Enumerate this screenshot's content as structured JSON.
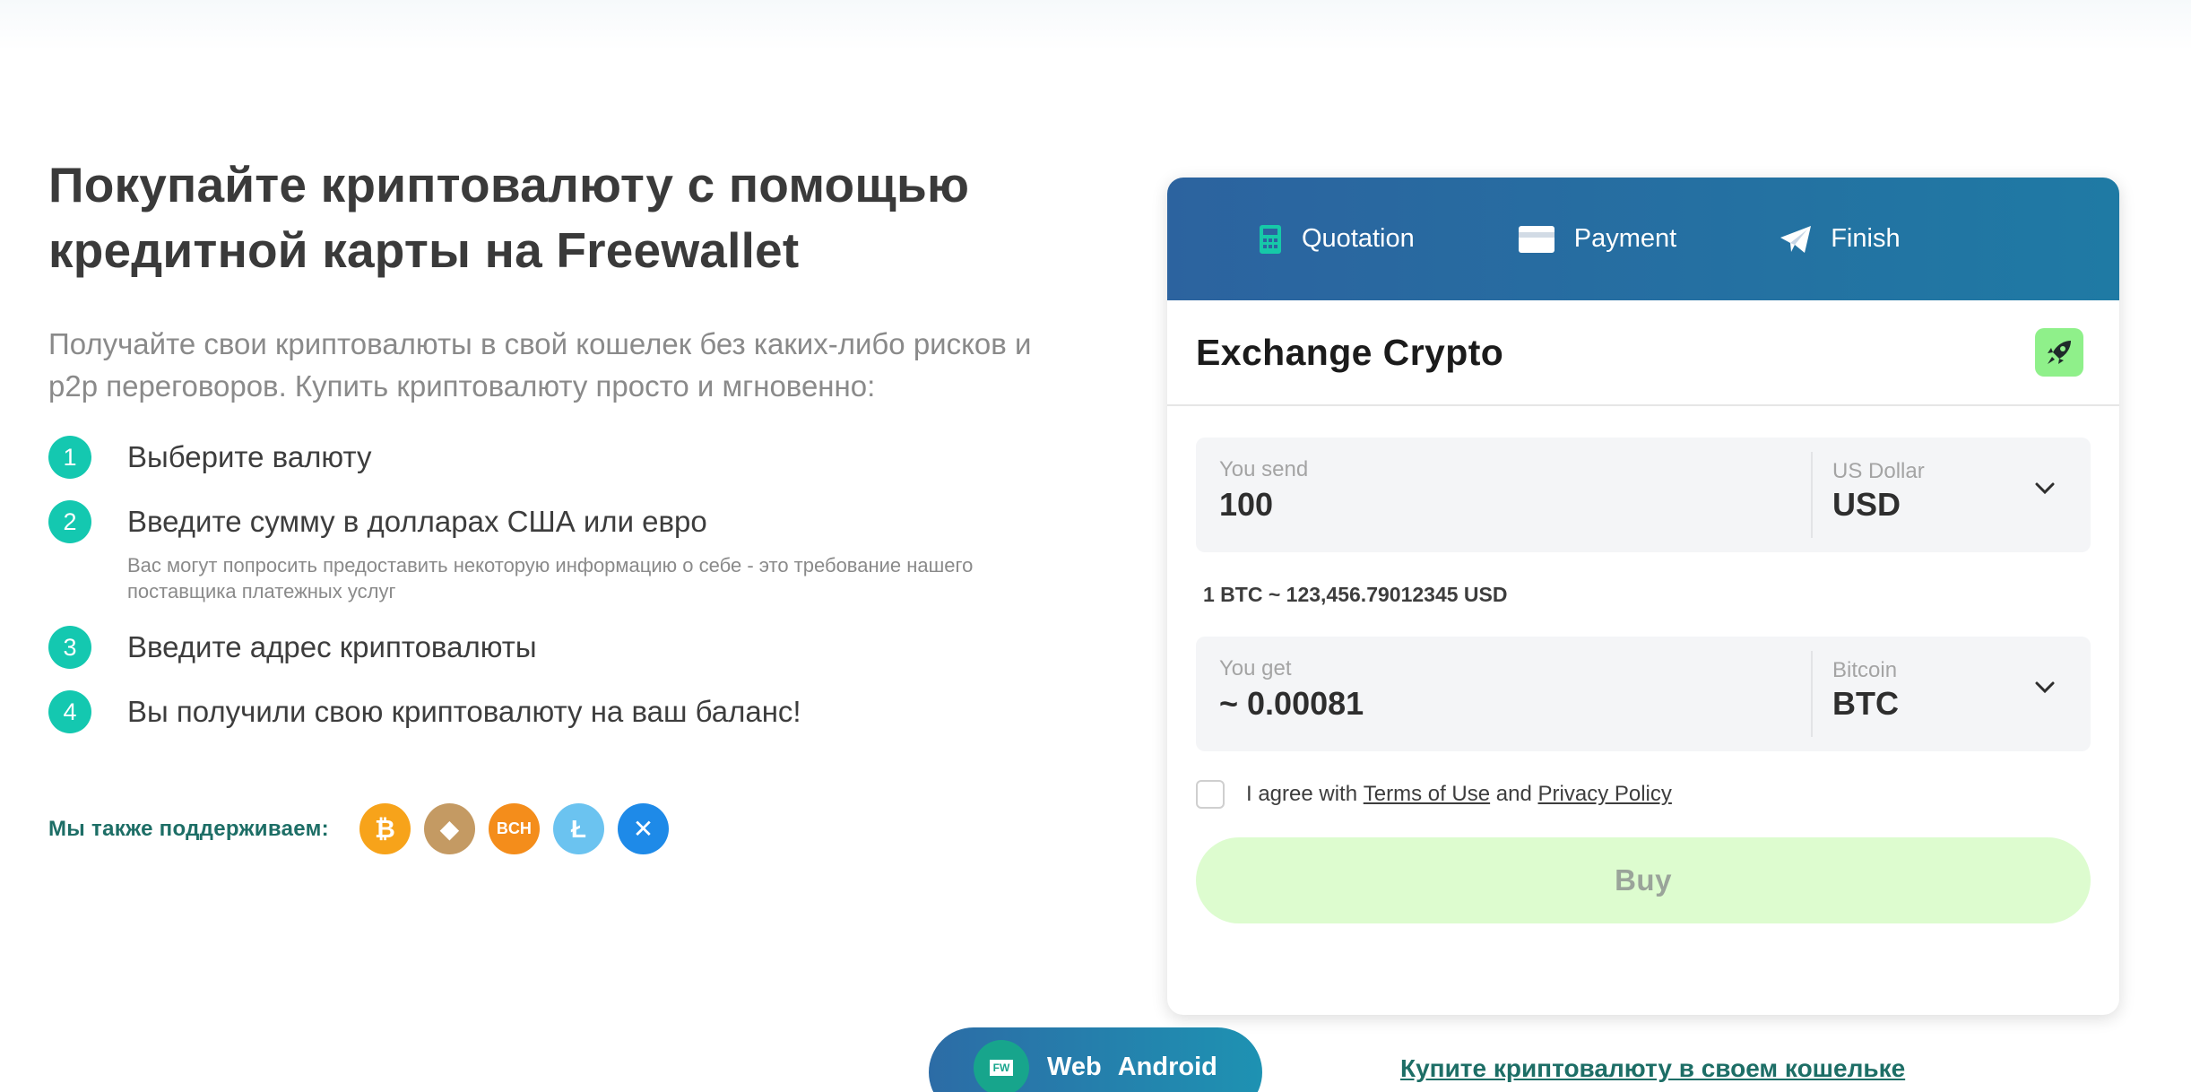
{
  "hero": {
    "title": "Покупайте криптовалюту с помощью кредитной карты на Freewallet",
    "subtitle": "Получайте свои криптовалюты в свой кошелек без каких-либо рисков и p2p переговоров. Купить криптовалюту просто и мгновенно:"
  },
  "steps": [
    {
      "num": "1",
      "text": "Выберите валюту",
      "note": ""
    },
    {
      "num": "2",
      "text": "Введите сумму в долларах США или евро",
      "note": "Вас могут попросить предоставить некоторую информацию о себе - это требование нашего поставщика платежных услуг"
    },
    {
      "num": "3",
      "text": "Введите адрес криптовалюты",
      "note": ""
    },
    {
      "num": "4",
      "text": "Вы получили свою криптовалюту на ваш баланс!",
      "note": ""
    }
  ],
  "supports": {
    "label": "Мы также поддерживаем:",
    "coins": [
      {
        "name": "btc",
        "symbol": "₿",
        "color": "#f7a31a"
      },
      {
        "name": "eth",
        "symbol": "◆",
        "color": "#c49a63"
      },
      {
        "name": "bch",
        "symbol": "BCH",
        "color": "#f48d1b"
      },
      {
        "name": "ltc",
        "symbol": "Ł",
        "color": "#6bc3f0"
      },
      {
        "name": "xrp",
        "symbol": "✕",
        "color": "#1e8ae8"
      }
    ]
  },
  "widget": {
    "tabs": [
      {
        "label": "Quotation",
        "icon": "calculator-icon"
      },
      {
        "label": "Payment",
        "icon": "credit-card-icon"
      },
      {
        "label": "Finish",
        "icon": "paper-plane-icon"
      }
    ],
    "title": "Exchange Crypto",
    "send": {
      "label": "You send",
      "value": "100",
      "currency_name": "US Dollar",
      "currency_code": "USD"
    },
    "rate": "1 BTC ~ 123,456.79012345 USD",
    "get": {
      "label": "You get",
      "value": "~ 0.00081",
      "currency_name": "Bitcoin",
      "currency_code": "BTC"
    },
    "agree": {
      "prefix": "I agree with",
      "terms": "Terms of Use",
      "and": "and",
      "privacy": "Privacy Policy"
    },
    "buy_label": "Buy",
    "colors": {
      "header_start": "#2c639f",
      "header_end": "#1f7aa4",
      "buy_bg": "#ddfccf",
      "accent": "#14c8b0"
    }
  },
  "bottom": {
    "app_badge": "FW",
    "app_web": "Web",
    "app_android": "Android",
    "link": "Купите криптовалюту в своем кошельке"
  }
}
